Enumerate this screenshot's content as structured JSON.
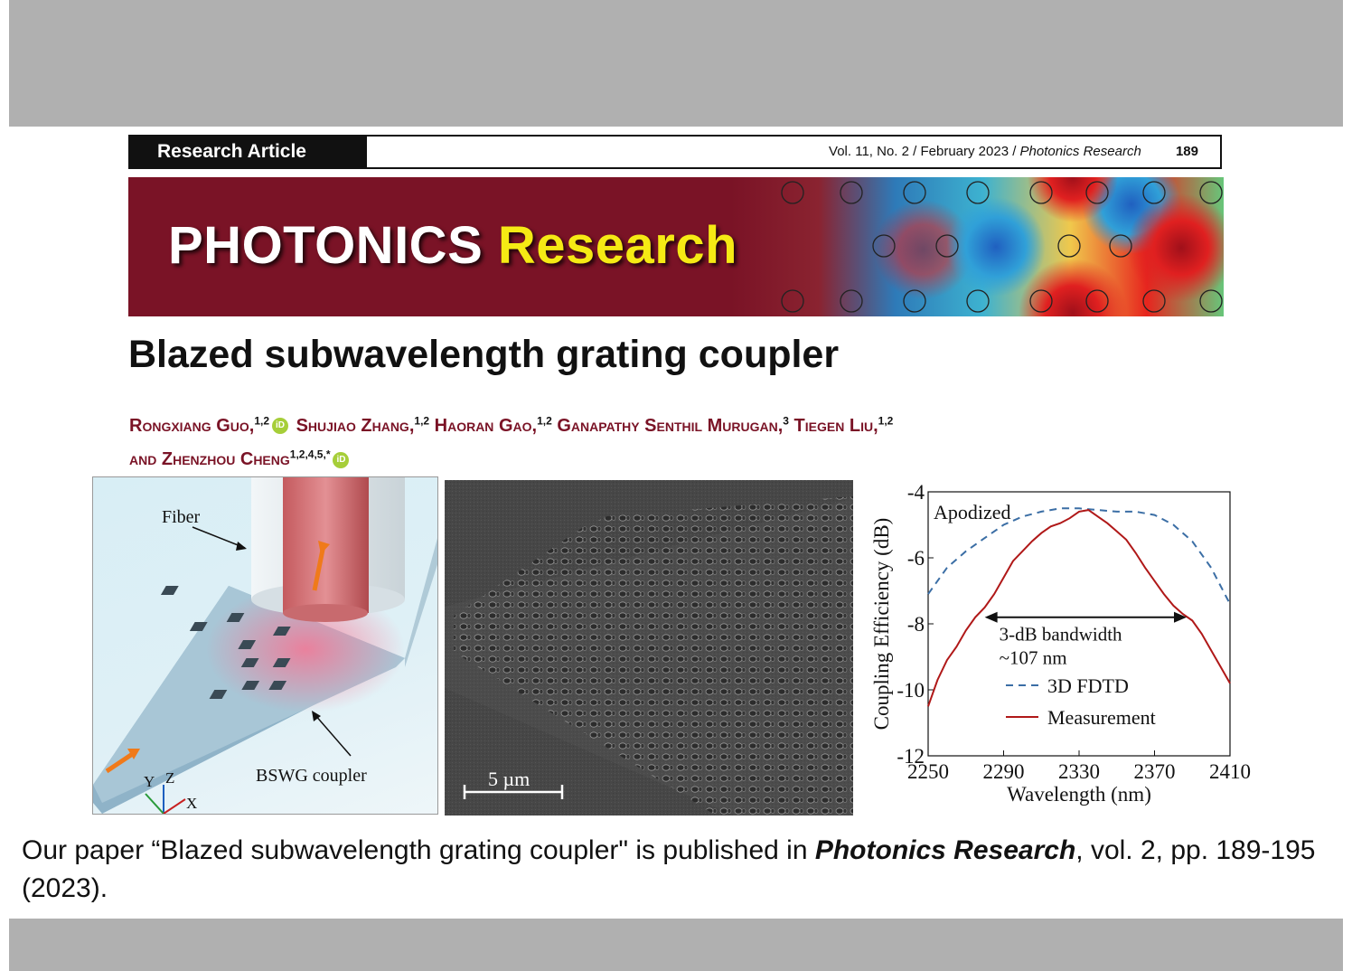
{
  "header": {
    "article_type": "Research Article",
    "volume_issue": "Vol. 11, No. 2 / February 2023 /",
    "journal": "Photonics Research",
    "page": "189"
  },
  "banner": {
    "title_white": "PHOTONICS",
    "title_yellow": "Research"
  },
  "paper": {
    "title": "Blazed subwavelength grating coupler",
    "authors": [
      {
        "name": "Rongxiang Guo,",
        "sup": "1,2",
        "orcid": true
      },
      {
        "name": "Shujiao Zhang,",
        "sup": "1,2",
        "orcid": false
      },
      {
        "name": "Haoran Gao,",
        "sup": "1,2",
        "orcid": false
      },
      {
        "name": "Ganapathy Senthil Murugan,",
        "sup": "3",
        "orcid": false
      },
      {
        "name": "Tiegen Liu,",
        "sup": "1,2",
        "orcid": false
      },
      {
        "name": "and Zhenzhou Cheng",
        "sup": "1,2,4,5,*",
        "orcid": true
      }
    ],
    "orcid_glyph": "iD"
  },
  "fig1": {
    "label_fiber": "Fiber",
    "label_coupler": "BSWG coupler",
    "axis_y": "Y",
    "axis_z": "Z",
    "axis_x": "X"
  },
  "fig2": {
    "scale_label": "5 µm"
  },
  "chart_data": {
    "type": "line",
    "xlabel": "Wavelength (nm)",
    "ylabel": "Coupling Efficiency (dB)",
    "xlim": [
      2250,
      2410
    ],
    "ylim": [
      -12,
      -4
    ],
    "xticks": [
      2250,
      2290,
      2330,
      2370,
      2410
    ],
    "yticks": [
      -4,
      -6,
      -8,
      -10,
      -12
    ],
    "annotation": "Apodized",
    "bandwidth_label": [
      "3-dB bandwidth",
      "~107 nm"
    ],
    "bandwidth_range": [
      2280,
      2387
    ],
    "bandwidth_level": -7.8,
    "legend_position": "bottom-right",
    "series": [
      {
        "name": "3D FDTD",
        "style": "dashed",
        "color": "#3b6ea5",
        "x": [
          2250,
          2260,
          2270,
          2280,
          2290,
          2300,
          2310,
          2320,
          2330,
          2340,
          2350,
          2360,
          2370,
          2380,
          2390,
          2400,
          2410
        ],
        "y": [
          -7.1,
          -6.3,
          -5.8,
          -5.4,
          -5.0,
          -4.75,
          -4.6,
          -4.5,
          -4.5,
          -4.55,
          -4.6,
          -4.6,
          -4.7,
          -5.0,
          -5.5,
          -6.3,
          -7.4
        ]
      },
      {
        "name": "Measurement",
        "style": "solid",
        "color": "#b01818",
        "x": [
          2250,
          2255,
          2260,
          2265,
          2270,
          2275,
          2280,
          2285,
          2290,
          2295,
          2300,
          2305,
          2310,
          2315,
          2320,
          2325,
          2330,
          2335,
          2340,
          2345,
          2350,
          2355,
          2360,
          2365,
          2370,
          2375,
          2380,
          2385,
          2390,
          2395,
          2400,
          2405,
          2410
        ],
        "y": [
          -10.5,
          -9.7,
          -9.1,
          -8.7,
          -8.2,
          -7.8,
          -7.5,
          -7.1,
          -6.6,
          -6.1,
          -5.8,
          -5.5,
          -5.25,
          -5.05,
          -4.95,
          -4.8,
          -4.6,
          -4.55,
          -4.75,
          -4.95,
          -5.2,
          -5.45,
          -5.85,
          -6.3,
          -6.7,
          -7.1,
          -7.45,
          -7.7,
          -7.9,
          -8.3,
          -8.8,
          -9.3,
          -9.8
        ]
      }
    ]
  },
  "caption": {
    "prefix": "Our paper  “Blazed subwavelength grating coupler\" is published in ",
    "journal": "Photonics Research",
    "suffix": ", vol. 2, pp. 189-195 (2023)."
  },
  "colors": {
    "maroon": "#7a1326",
    "banner_yellow": "#f5ea14",
    "band_gray": "#b0b0b0",
    "orcid_green": "#a6ce39"
  }
}
